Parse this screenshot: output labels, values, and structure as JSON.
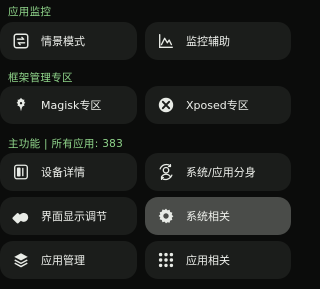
{
  "sections": {
    "app_monitor": "应用监控",
    "framework": "框架管理专区",
    "main": "主功能 | 所有应用: 383"
  },
  "items": {
    "scene_mode": {
      "label": "情景模式",
      "icon": "scene-mode-icon"
    },
    "monitor_assist": {
      "label": "监控辅助",
      "icon": "chart-line-icon"
    },
    "magisk": {
      "label": "Magisk专区",
      "icon": "magisk-icon"
    },
    "xposed": {
      "label": "Xposed专区",
      "icon": "xposed-icon"
    },
    "device_info": {
      "label": "设备详情",
      "icon": "device-icon"
    },
    "clone": {
      "label": "系统/应用分身",
      "icon": "clone-user-icon"
    },
    "ui_tuning": {
      "label": "界面显示调节",
      "icon": "shapes-icon"
    },
    "system": {
      "label": "系统相关",
      "icon": "settings-gear-icon"
    },
    "app_manage": {
      "label": "应用管理",
      "icon": "layers-icon"
    },
    "app_related": {
      "label": "应用相关",
      "icon": "grid-icon"
    }
  },
  "colors": {
    "accent": "#8fd48a",
    "card_bg": "#1b1d1b",
    "card_active_bg": "#4a4c49",
    "page_bg": "#0b0c0b"
  }
}
